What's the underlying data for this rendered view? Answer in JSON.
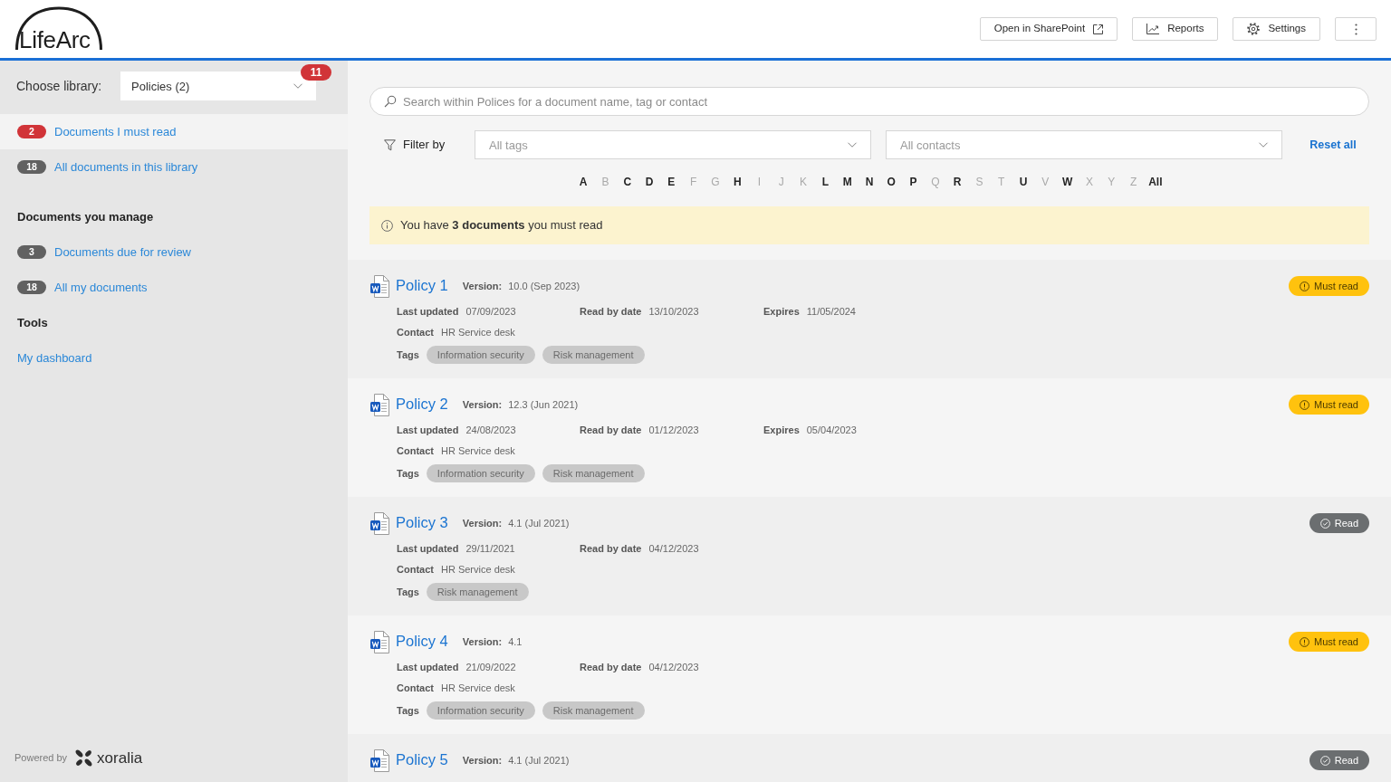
{
  "header": {
    "logo": "LifeArc",
    "buttons": [
      {
        "kind": "external",
        "label": "Open in SharePoint"
      },
      {
        "kind": "reports",
        "label": "Reports"
      },
      {
        "kind": "settings",
        "label": "Settings"
      },
      {
        "kind": "more"
      }
    ]
  },
  "sidebar": {
    "library": {
      "label": "Choose library:",
      "value": "Policies (2)",
      "count": "11"
    },
    "nav": [
      {
        "count": "2",
        "color": "#d13438",
        "label": "Documents I must read",
        "selected": true
      },
      {
        "count": "18",
        "color": "#616161",
        "label": "All documents in this library",
        "selected": false
      }
    ],
    "sections": [
      {
        "title": "Documents you manage",
        "items": [
          {
            "count": "3",
            "color": "#616161",
            "label": "Documents due for review",
            "selected": false
          },
          {
            "count": "18",
            "color": "#616161",
            "label": "All my documents",
            "selected": false
          }
        ]
      },
      {
        "title": "Tools",
        "items": [
          {
            "label": "My dashboard",
            "selected": false
          }
        ]
      }
    ],
    "footer": {
      "powered_by": "Powered by",
      "brand": "xoralia"
    }
  },
  "main": {
    "search": {
      "placeholder": "Search within Polices for a document name, tag or contact"
    },
    "filter": {
      "label": "Filter by",
      "tags": {
        "placeholder": "All tags"
      },
      "contacts": {
        "placeholder": "All contacts"
      },
      "reset": "Reset all"
    },
    "alphabet": [
      {
        "letter": "A",
        "disabled": false
      },
      {
        "letter": "B",
        "disabled": true
      },
      {
        "letter": "C",
        "disabled": false
      },
      {
        "letter": "D",
        "disabled": false
      },
      {
        "letter": "E",
        "disabled": false
      },
      {
        "letter": "F",
        "disabled": true
      },
      {
        "letter": "G",
        "disabled": true
      },
      {
        "letter": "H",
        "disabled": false
      },
      {
        "letter": "I",
        "disabled": true
      },
      {
        "letter": "J",
        "disabled": true
      },
      {
        "letter": "K",
        "disabled": true
      },
      {
        "letter": "L",
        "disabled": false
      },
      {
        "letter": "M",
        "disabled": false
      },
      {
        "letter": "N",
        "disabled": false
      },
      {
        "letter": "O",
        "disabled": false
      },
      {
        "letter": "P",
        "disabled": false
      },
      {
        "letter": "Q",
        "disabled": true
      },
      {
        "letter": "R",
        "disabled": false
      },
      {
        "letter": "S",
        "disabled": true
      },
      {
        "letter": "T",
        "disabled": true
      },
      {
        "letter": "U",
        "disabled": false
      },
      {
        "letter": "V",
        "disabled": true
      },
      {
        "letter": "W",
        "disabled": false
      },
      {
        "letter": "X",
        "disabled": true
      },
      {
        "letter": "Y",
        "disabled": true
      },
      {
        "letter": "Z",
        "disabled": true
      },
      {
        "letter": "All",
        "disabled": false
      }
    ],
    "notice": "You have **3 documents** you must read",
    "documents": [
      {
        "title": "Policy 1",
        "version": {
          "label": "Version:",
          "value": "10.0 (Sep 2023)"
        },
        "status": {
          "kind": "must_read",
          "label": "Must read"
        },
        "dates": [
          {
            "label": "Last updated",
            "value": "07/09/2023"
          },
          {
            "label": "Read by date",
            "value": "13/10/2023"
          },
          {
            "label": "Expires",
            "value": "11/05/2024"
          }
        ],
        "contact": {
          "label": "Contact",
          "value": "HR Service desk"
        },
        "tags": {
          "label": "Tags",
          "items": [
            "Information security",
            "Risk management"
          ]
        }
      },
      {
        "title": "Policy 2",
        "version": {
          "label": "Version:",
          "value": "12.3 (Jun 2021)"
        },
        "status": {
          "kind": "must_read",
          "label": "Must read"
        },
        "dates": [
          {
            "label": "Last updated",
            "value": "24/08/2023"
          },
          {
            "label": "Read by date",
            "value": "01/12/2023"
          },
          {
            "label": "Expires",
            "value": "05/04/2023"
          }
        ],
        "contact": {
          "label": "Contact",
          "value": "HR Service desk"
        },
        "tags": {
          "label": "Tags",
          "items": [
            "Information security",
            "Risk management"
          ]
        }
      },
      {
        "title": "Policy 3",
        "version": {
          "label": "Version:",
          "value": "4.1 (Jul 2021)"
        },
        "status": {
          "kind": "read",
          "label": "Read"
        },
        "dates": [
          {
            "label": "Last updated",
            "value": "29/11/2021"
          },
          {
            "label": "Read by date",
            "value": "04/12/2023"
          }
        ],
        "contact": {
          "label": "Contact",
          "value": "HR Service desk"
        },
        "tags": {
          "label": "Tags",
          "items": [
            "Risk management"
          ]
        }
      },
      {
        "title": "Policy 4",
        "version": {
          "label": "Version:",
          "value": "4.1"
        },
        "status": {
          "kind": "must_read",
          "label": "Must read"
        },
        "dates": [
          {
            "label": "Last updated",
            "value": "21/09/2022"
          },
          {
            "label": "Read by date",
            "value": "04/12/2023"
          }
        ],
        "contact": {
          "label": "Contact",
          "value": "HR Service desk"
        },
        "tags": {
          "label": "Tags",
          "items": [
            "Information security",
            "Risk management"
          ]
        }
      },
      {
        "title": "Policy 5",
        "version": {
          "label": "Version:",
          "value": "4.1 (Jul 2021)"
        },
        "status": {
          "kind": "read",
          "label": "Read"
        }
      }
    ]
  }
}
